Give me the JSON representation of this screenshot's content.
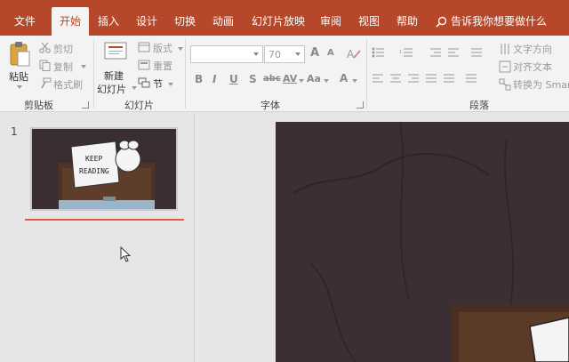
{
  "tabs": [
    {
      "label": "文件",
      "active": false
    },
    {
      "label": "开始",
      "active": true
    },
    {
      "label": "插入",
      "active": false
    },
    {
      "label": "设计",
      "active": false
    },
    {
      "label": "切换",
      "active": false
    },
    {
      "label": "动画",
      "active": false
    },
    {
      "label": "幻灯片放映",
      "active": false
    },
    {
      "label": "审阅",
      "active": false
    },
    {
      "label": "视图",
      "active": false
    },
    {
      "label": "帮助",
      "active": false
    }
  ],
  "search": {
    "label": "告诉我你想要做什么"
  },
  "clipboard": {
    "group_label": "剪贴板",
    "paste_label": "粘贴",
    "cut_label": "剪切",
    "copy_label": "复制",
    "format_painter_label": "格式刷"
  },
  "slides_group": {
    "group_label": "幻灯片",
    "new_slide_line1": "新建",
    "new_slide_line2": "幻灯片",
    "layout_label": "版式",
    "reset_label": "重置",
    "section_label": "节"
  },
  "font": {
    "group_label": "字体",
    "font_size": "70",
    "bold": "B",
    "italic": "I",
    "underline": "U",
    "shadow": "S",
    "strikethrough": "abc",
    "spacing": "AV",
    "case": "Aa",
    "grow": "A",
    "shrink": "A",
    "color": "A"
  },
  "paragraph": {
    "group_label": "段落",
    "text_direction_label": "文字方向",
    "align_text_label": "对齐文本",
    "convert_smartart_label": "转换为 Smar"
  },
  "thumbnails": [
    {
      "number": "1",
      "sign_line1": "KEEP",
      "sign_line2": "READING"
    }
  ],
  "colors": {
    "accent": "#b7472a",
    "ribbon_bg": "#f3f3f3",
    "pane_bg": "#e6e6e6",
    "slide_bg": "#3b2f33"
  }
}
